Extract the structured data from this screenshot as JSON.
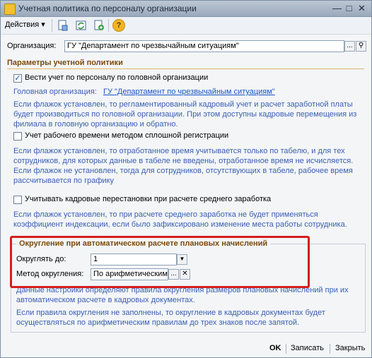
{
  "window": {
    "title": "Учетная политика по персоналу организации",
    "min_glyph": "—",
    "max_glyph": "□",
    "close_glyph": "✕"
  },
  "toolbar": {
    "actions_label": "Действия ▾",
    "help_glyph": "?"
  },
  "organization": {
    "label": "Организация:",
    "value": "ГУ \"Департамент по чрезвычайным ситуациям\"",
    "select_glyph": "...",
    "open_glyph": "⚲"
  },
  "section": {
    "title": "Параметры учетной политики"
  },
  "head_org_check": {
    "checked_glyph": "✓",
    "label": "Вести учет по персоналу по головной организации",
    "head_label": "Головная организация:",
    "head_value": "ГУ \"Департамент по чрезвычайным ситуациям\"",
    "desc": "Если флажок установлен, то регламентированный кадровый учет и расчет заработной платы будет производиться по головной организации. При этом доступны кадровые перемещения из филиала в головную организацию и обратно."
  },
  "worktime_check": {
    "label": "Учет рабочего времени методом сплошной регистрации",
    "desc": "Если флажок установлен, то отработанное время учитывается только по табелю, и для тех сотрудников, для которых данные в табеле не введены, отработанное время не исчисляется. Если флажок не установлен, тогда для сотрудников, отсутствующих в табеле, рабочее время рассчитывается по графику"
  },
  "transfer_check": {
    "label": "Учитывать кадровые перестановки при расчете среднего заработка",
    "desc": "Если флажок установлен, то при расчете среднего заработка не будет применяться коэффициент индексации, если было зафиксировано изменение места работы сотрудника."
  },
  "rounding": {
    "title": "Округление при автоматическом расчете плановых начислений",
    "round_to_label": "Округлять до:",
    "round_to_value": "1",
    "dropdown_glyph": "▼",
    "method_label": "Метод округления:",
    "method_value": "По арифметическим",
    "select_glyph": "...",
    "clear_glyph": "✕",
    "desc1": "Данные настройки определяют правила округления размеров плановых начислений при их автоматическом расчете в кадровых документах.",
    "desc2": "Если правила округления не заполнены, то округление в кадровых документах будет осуществляться по арифметическим правилам до трех знаков после запятой."
  },
  "buttons": {
    "ok": "OK",
    "save": "Записать",
    "close": "Закрыть"
  },
  "colors": {
    "accent_blue": "#3a5fb2",
    "section_brown": "#7a4a0e",
    "highlight_red": "#d51e1e"
  }
}
